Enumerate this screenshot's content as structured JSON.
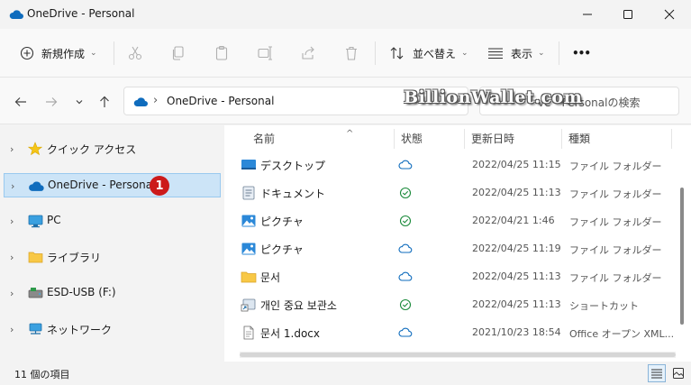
{
  "window": {
    "title": "OneDrive - Personal"
  },
  "toolbar": {
    "new_label": "新規作成",
    "sort_label": "並べ替え",
    "view_label": "表示",
    "more_label": "•••"
  },
  "address": {
    "crumb": "OneDrive - Personal",
    "search_placeholder": "ve - Personalの検索"
  },
  "watermark": "BillionWallet.com",
  "sidebar": {
    "items": [
      {
        "label": "クイック アクセス",
        "icon": "star-icon"
      },
      {
        "label": "OneDrive - Personal",
        "icon": "onedrive-cloud-icon",
        "badge": "1"
      },
      {
        "label": "PC",
        "icon": "monitor-icon"
      },
      {
        "label": "ライブラリ",
        "icon": "folder-icon"
      },
      {
        "label": "ESD-USB (F:)",
        "icon": "usb-drive-icon"
      },
      {
        "label": "ネットワーク",
        "icon": "network-icon"
      }
    ]
  },
  "columns": {
    "name": "名前",
    "status": "状態",
    "date": "更新日時",
    "type": "種類"
  },
  "files": [
    {
      "name": "デスクトップ",
      "icon": "desktop-folder-icon",
      "status": "cloud",
      "date": "2022/04/25 11:15",
      "type": "ファイル フォルダー"
    },
    {
      "name": "ドキュメント",
      "icon": "documents-folder-icon",
      "status": "synced",
      "date": "2022/04/25 11:13",
      "type": "ファイル フォルダー"
    },
    {
      "name": "ピクチャ",
      "icon": "pictures-folder-icon",
      "status": "synced",
      "date": "2022/04/21 1:46",
      "type": "ファイル フォルダー"
    },
    {
      "name": "ピクチャ",
      "icon": "pictures-folder-icon",
      "status": "cloud",
      "date": "2022/04/25 11:19",
      "type": "ファイル フォルダー"
    },
    {
      "name": "문서",
      "icon": "folder-icon",
      "status": "cloud",
      "date": "2022/04/25 11:13",
      "type": "ファイル フォルダー"
    },
    {
      "name": "개인 중요 보관소",
      "icon": "shortcut-icon",
      "status": "synced",
      "date": "2022/04/25 11:13",
      "type": "ショートカット"
    },
    {
      "name": "문서 1.docx",
      "icon": "document-file-icon",
      "status": "cloud",
      "date": "2021/10/23 18:54",
      "type": "Office オープン XML..."
    }
  ],
  "status": {
    "count": "11 個の項目"
  },
  "colors": {
    "onedrive_blue": "#0f6cbd",
    "selected_bg": "#cce4f7",
    "badge_red": "#cc1a1a",
    "synced_green": "#1a8a3a"
  }
}
